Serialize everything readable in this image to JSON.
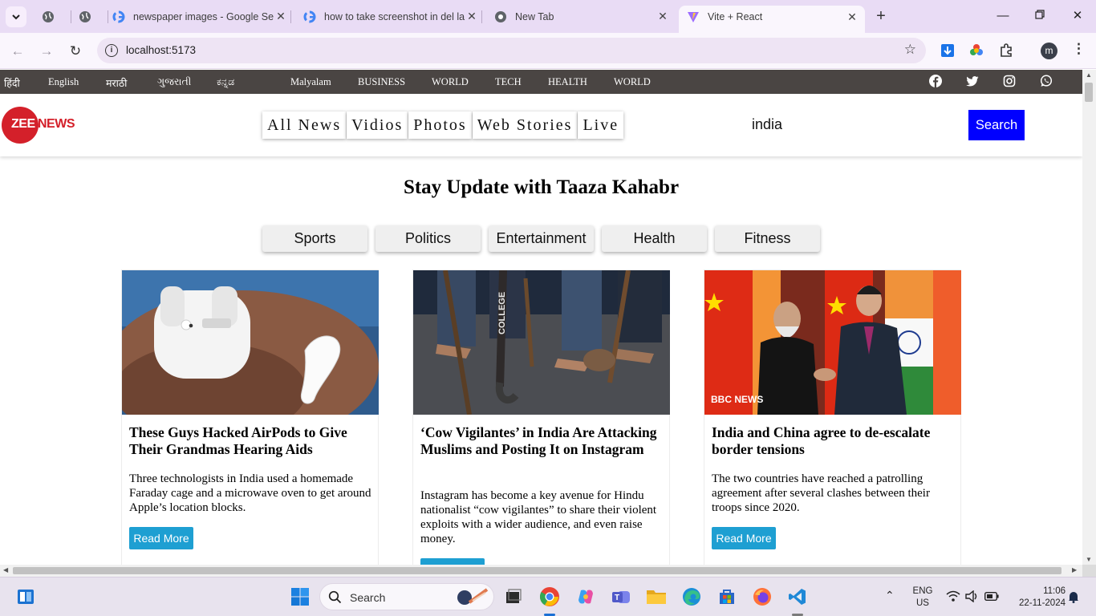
{
  "browser": {
    "tabs": [
      {
        "title": "",
        "favicon": "globe-icon"
      },
      {
        "title": "",
        "favicon": "globe-icon"
      },
      {
        "title": "newspaper images - Google Se",
        "favicon": "google-icon"
      },
      {
        "title": "how to take screenshot in del la",
        "favicon": "google-icon"
      },
      {
        "title": "New Tab",
        "favicon": "chrome-icon"
      },
      {
        "title": "Vite + React",
        "favicon": "vite-icon",
        "active": true
      }
    ],
    "url": "localhost:5173",
    "profile_initial": "m"
  },
  "topnav": {
    "languages": [
      "हिंदी",
      "English",
      "मराठी",
      "ગુજરાતી",
      "ಕನ್ನಡ",
      "Malyalam",
      "BUSINESS",
      "WORLD",
      "TECH",
      "HEALTH",
      "WORLD"
    ],
    "social": [
      "facebook-icon",
      "twitter-icon",
      "instagram-icon",
      "whatsapp-icon"
    ]
  },
  "header": {
    "logo_zee": "ZEE",
    "logo_news": "NEWS",
    "nav": [
      "All News",
      "Vidios",
      "Photos",
      "Web Stories",
      "Live"
    ],
    "search_value": "india",
    "search_button": "Search"
  },
  "headline": "Stay Update with Taaza Kahabr",
  "filters": [
    "Sports",
    "Politics",
    "Entertainment",
    "Health",
    "Fitness"
  ],
  "cards": [
    {
      "title": "These Guys Hacked AirPods to Give Their Grandmas Hearing Aids",
      "description": "Three technologists in India used a homemade Faraday cage and a microwave oven to get around Apple’s location blocks.",
      "button": "Read More"
    },
    {
      "title": "‘Cow Vigilantes’ in India Are Attacking Muslims and Posting It on Instagram",
      "description": "Instagram has become a key avenue for Hindu nationalist “cow vigilantes” to share their violent exploits with a wider audience, and even raise money.",
      "button": "Read More",
      "image_text": "COLLEGE"
    },
    {
      "title": "India and China agree to de-escalate border tensions",
      "description": "The two countries have reached a patrolling agreement after several clashes between their troops since 2020.",
      "button": "Read More",
      "image_text": "BBC NEWS"
    }
  ],
  "taskbar": {
    "search_label": "Search",
    "lang": "ENG",
    "region": "US",
    "time": "11:06",
    "date": "22-11-2024"
  }
}
